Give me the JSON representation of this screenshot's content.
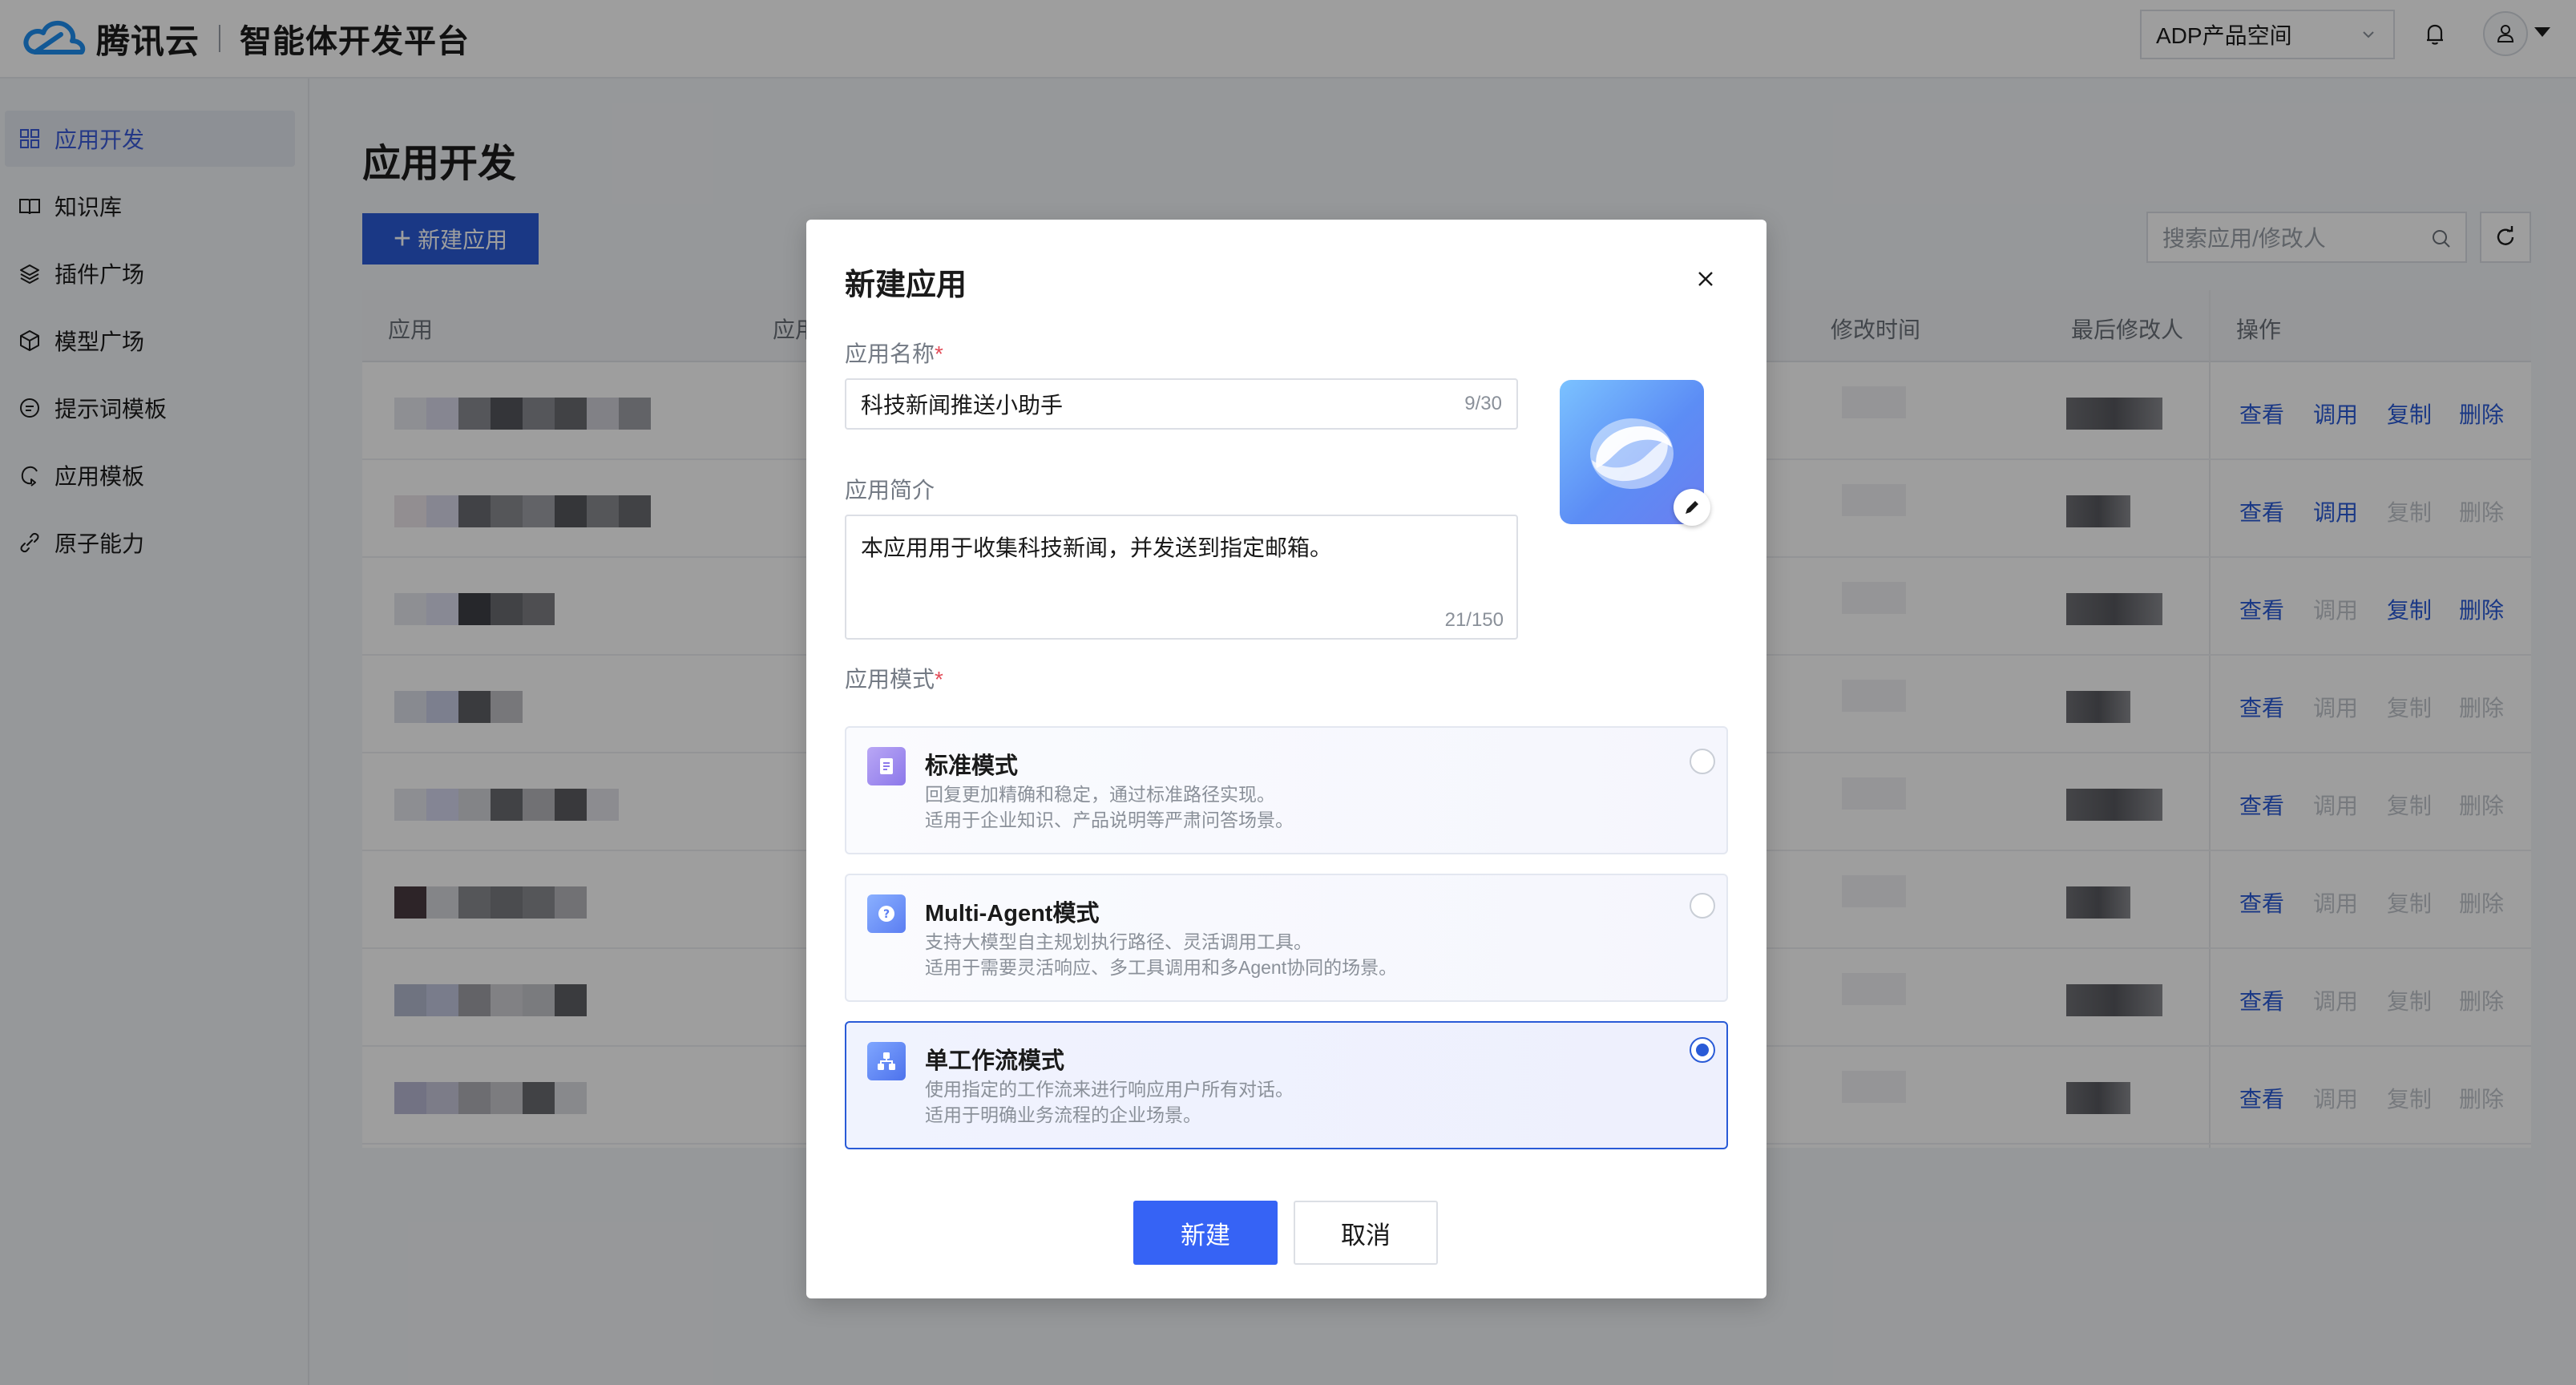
{
  "header": {
    "brand": "腾讯云",
    "platform": "智能体开发平台",
    "space_select": "ADP产品空间"
  },
  "sidebar": {
    "items": [
      {
        "label": "应用开发",
        "icon": "grid-icon",
        "active": true
      },
      {
        "label": "知识库",
        "icon": "book-icon"
      },
      {
        "label": "插件广场",
        "icon": "layers-icon"
      },
      {
        "label": "模型广场",
        "icon": "cube-icon"
      },
      {
        "label": "提示词模板",
        "icon": "message-icon"
      },
      {
        "label": "应用模板",
        "icon": "template-icon"
      },
      {
        "label": "原子能力",
        "icon": "link-icon"
      }
    ]
  },
  "main": {
    "title": "应用开发",
    "new_app_button": "新建应用",
    "search_placeholder": "搜索应用/修改人",
    "table": {
      "headers": [
        "应用",
        "应用",
        "修改时间",
        "最后修改人",
        "操作"
      ],
      "rows": [
        {
          "ops": [
            {
              "label": "查看",
              "enabled": true
            },
            {
              "label": "调用",
              "enabled": true
            },
            {
              "label": "复制",
              "enabled": true
            },
            {
              "label": "删除",
              "enabled": true
            }
          ]
        },
        {
          "ops": [
            {
              "label": "查看",
              "enabled": true
            },
            {
              "label": "调用",
              "enabled": true
            },
            {
              "label": "复制",
              "enabled": false
            },
            {
              "label": "删除",
              "enabled": false
            }
          ]
        },
        {
          "ops": [
            {
              "label": "查看",
              "enabled": true
            },
            {
              "label": "调用",
              "enabled": false
            },
            {
              "label": "复制",
              "enabled": true
            },
            {
              "label": "删除",
              "enabled": true
            }
          ]
        },
        {
          "ops": [
            {
              "label": "查看",
              "enabled": true
            },
            {
              "label": "调用",
              "enabled": false
            },
            {
              "label": "复制",
              "enabled": false
            },
            {
              "label": "删除",
              "enabled": false
            }
          ]
        },
        {
          "ops": [
            {
              "label": "查看",
              "enabled": true
            },
            {
              "label": "调用",
              "enabled": false
            },
            {
              "label": "复制",
              "enabled": false
            },
            {
              "label": "删除",
              "enabled": false
            }
          ]
        },
        {
          "ops": [
            {
              "label": "查看",
              "enabled": true
            },
            {
              "label": "调用",
              "enabled": false
            },
            {
              "label": "复制",
              "enabled": false
            },
            {
              "label": "删除",
              "enabled": false
            }
          ]
        },
        {
          "ops": [
            {
              "label": "查看",
              "enabled": true
            },
            {
              "label": "调用",
              "enabled": false
            },
            {
              "label": "复制",
              "enabled": false
            },
            {
              "label": "删除",
              "enabled": false
            }
          ]
        },
        {
          "ops": [
            {
              "label": "查看",
              "enabled": true
            },
            {
              "label": "调用",
              "enabled": false
            },
            {
              "label": "复制",
              "enabled": false
            },
            {
              "label": "删除",
              "enabled": false
            }
          ]
        }
      ]
    }
  },
  "modal": {
    "title": "新建应用",
    "name_label": "应用名称",
    "name_value": "科技新闻推送小助手",
    "name_counter": "9/30",
    "desc_label": "应用简介",
    "desc_value": "本应用用于收集科技新闻，并发送到指定邮箱。",
    "desc_counter": "21/150",
    "mode_label": "应用模式",
    "required_mark": "*",
    "modes": [
      {
        "name": "标准模式",
        "desc1": "回复更加精确和稳定，通过标准路径实现。",
        "desc2": "适用于企业知识、产品说明等严肃问答场景。",
        "icon": "document-icon",
        "selected": false
      },
      {
        "name": "Multi-Agent模式",
        "desc1": "支持大模型自主规划执行路径、灵活调用工具。",
        "desc2": "适用于需要灵活响应、多工具调用和多Agent协同的场景。",
        "icon": "question-icon",
        "selected": false
      },
      {
        "name": "单工作流模式",
        "desc1": "使用指定的工作流来进行响应用户所有对话。",
        "desc2": "适用于明确业务流程的企业场景。",
        "icon": "workflow-icon",
        "selected": true
      }
    ],
    "create_button": "新建",
    "cancel_button": "取消"
  },
  "colors": {
    "primary": "#2a5bd7",
    "create_button": "#3663f5",
    "required": "#e34d59"
  }
}
